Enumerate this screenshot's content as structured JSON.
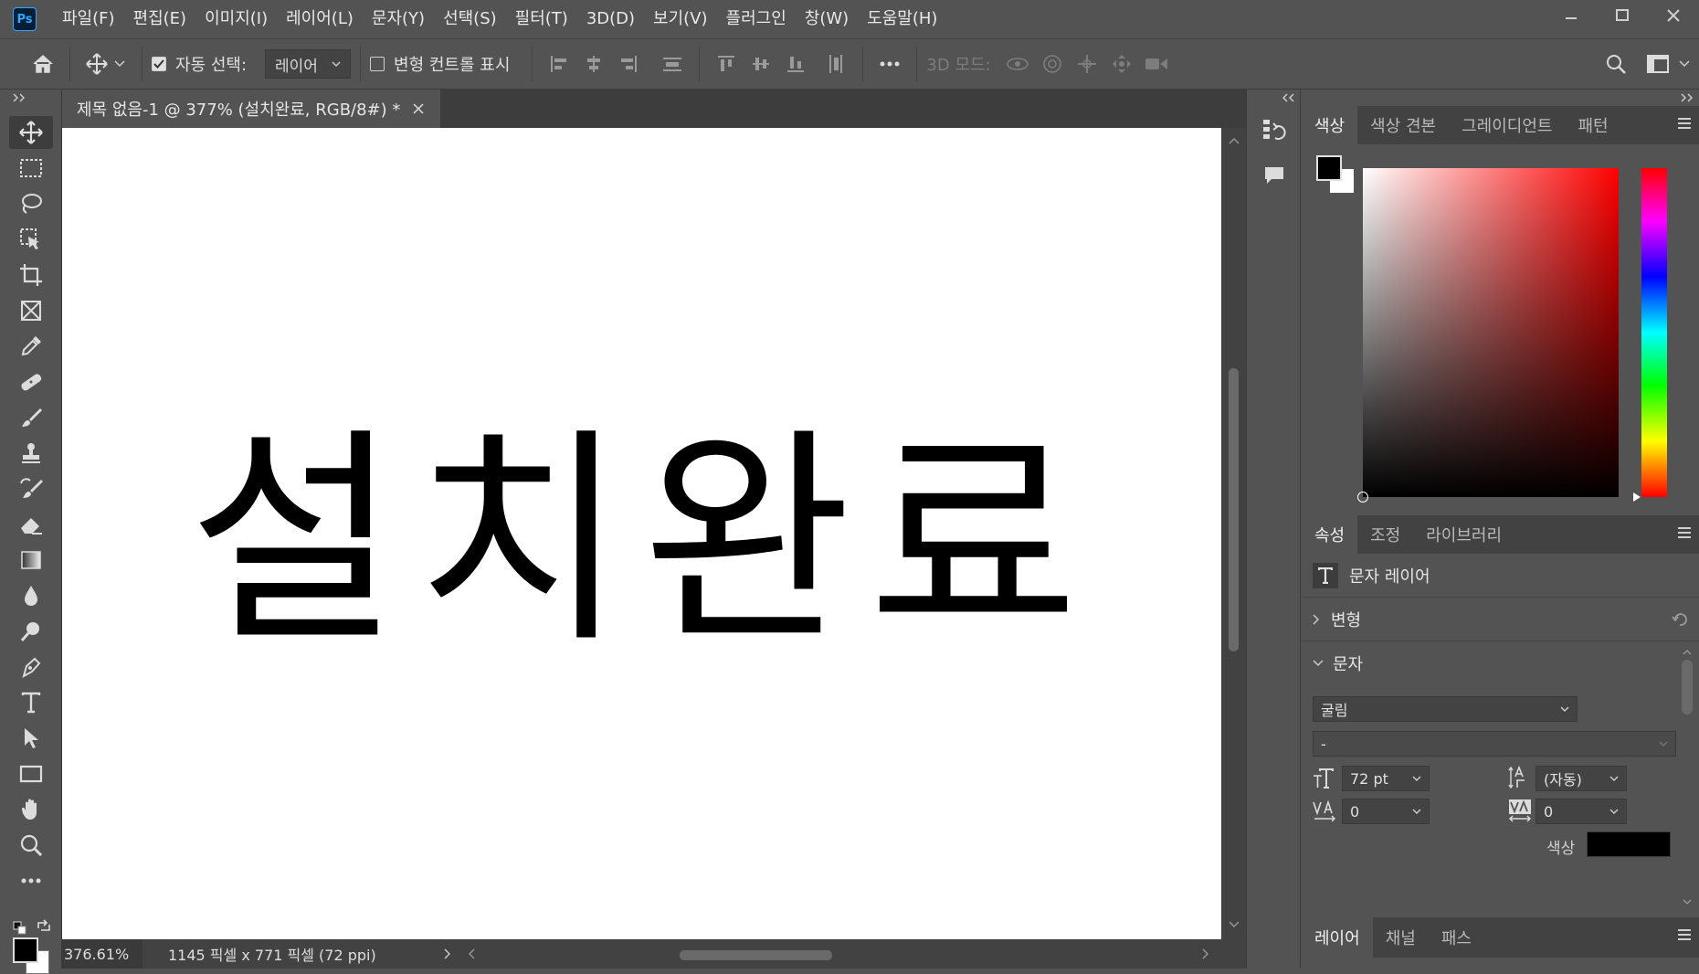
{
  "app": {
    "logo": "Ps"
  },
  "menu": [
    "파일(F)",
    "편집(E)",
    "이미지(I)",
    "레이어(L)",
    "문자(Y)",
    "선택(S)",
    "필터(T)",
    "3D(D)",
    "보기(V)",
    "플러그인",
    "창(W)",
    "도움말(H)"
  ],
  "options_bar": {
    "auto_select_label": "자동 선택:",
    "auto_select_checked": true,
    "auto_select_target": "레이어",
    "show_transform_label": "변형 컨트롤 표시",
    "show_transform_checked": false,
    "mode_3d_label": "3D 모드:"
  },
  "document": {
    "tab_title": "제목 없음-1 @ 377% (설치완료, RGB/8#) *",
    "canvas_text": "설치완료",
    "zoom": "376.61%",
    "info": "1145 픽셀 x 771 픽셀 (72 ppi)"
  },
  "color_panel": {
    "tabs": [
      "색상",
      "색상 견본",
      "그레이디언트",
      "패턴"
    ],
    "foreground": "#000000",
    "background": "#ffffff"
  },
  "properties_panel": {
    "tabs": [
      "속성",
      "조정",
      "라이브러리"
    ],
    "layer_type": "문자 레이어",
    "transform_section": "변형",
    "character_section": "문자",
    "font_family": "굴림",
    "font_style": "-",
    "font_size": "72 pt",
    "leading": "(자동)",
    "kerning": "0",
    "tracking": "0",
    "color_label": "색상",
    "text_color": "#000000"
  },
  "layers_panel": {
    "tabs": [
      "레이어",
      "채널",
      "패스"
    ]
  }
}
